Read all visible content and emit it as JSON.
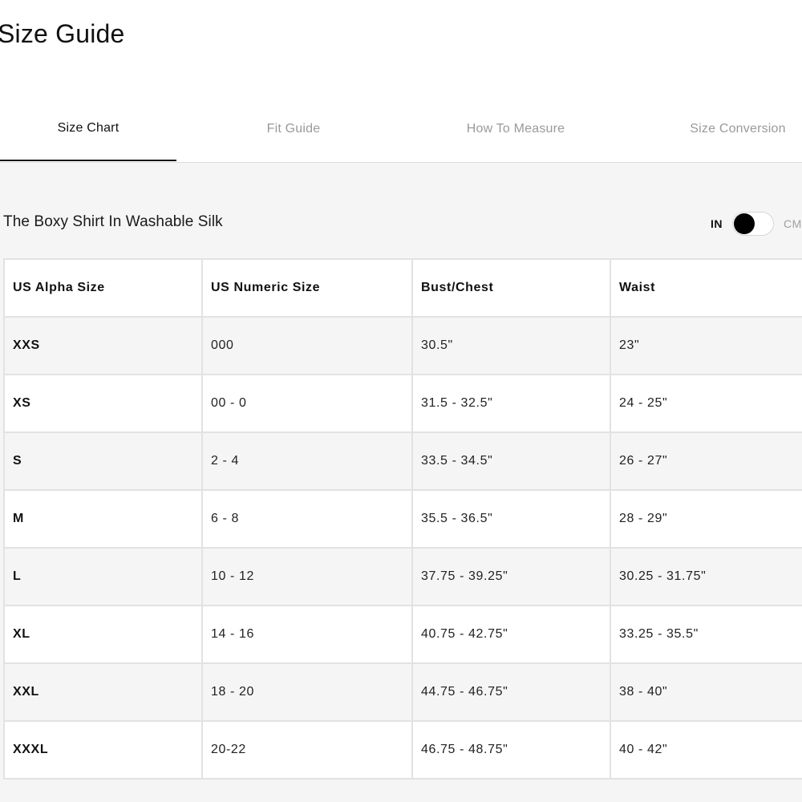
{
  "title": "Size Guide",
  "tabs": [
    {
      "label": "Size Chart",
      "active": true
    },
    {
      "label": "Fit Guide",
      "active": false
    },
    {
      "label": "How To Measure",
      "active": false
    },
    {
      "label": "Size Conversion",
      "active": false
    }
  ],
  "product": {
    "name": "The Boxy Shirt In Washable Silk"
  },
  "units": {
    "in_label": "IN",
    "cm_label": "CM",
    "selected": "IN"
  },
  "table": {
    "headers": [
      "US Alpha Size",
      "US Numeric Size",
      "Bust/Chest",
      "Waist"
    ],
    "rows": [
      [
        "XXS",
        "000",
        "30.5\"",
        "23\""
      ],
      [
        "XS",
        "00 - 0",
        "31.5 - 32.5\"",
        "24 - 25\""
      ],
      [
        "S",
        "2 - 4",
        "33.5 - 34.5\"",
        "26 - 27\""
      ],
      [
        "M",
        "6 - 8",
        "35.5 - 36.5\"",
        "28 - 29\""
      ],
      [
        "L",
        "10 - 12",
        "37.75 - 39.25\"",
        "30.25 - 31.75\""
      ],
      [
        "XL",
        "14 - 16",
        "40.75 - 42.75\"",
        "33.25 - 35.5\""
      ],
      [
        "XXL",
        "18 - 20",
        "44.75 - 46.75\"",
        "38 - 40\""
      ],
      [
        "XXXL",
        "20-22",
        "46.75 - 48.75\"",
        "40 - 42\""
      ]
    ]
  },
  "colors": {
    "text": "#111111",
    "muted_tab": "#9a9a9a",
    "panel_bg": "#f5f5f5",
    "border": "#e2e2e2",
    "toggle_knob": "#000000"
  }
}
